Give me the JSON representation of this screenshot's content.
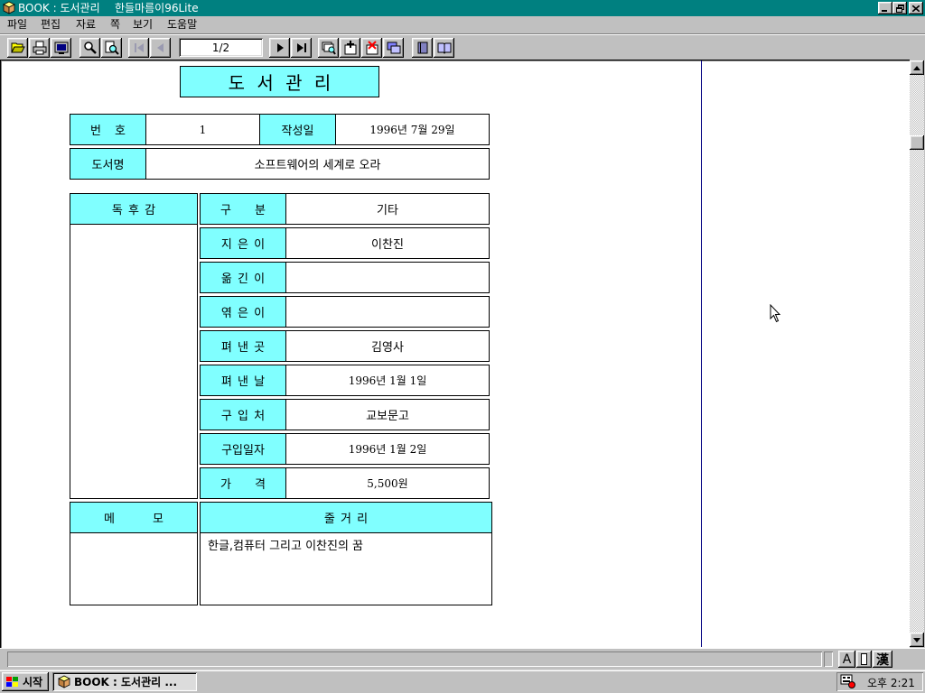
{
  "theme": {
    "titlebar": "#008080",
    "face": "#c0c0c0",
    "label_bg": "#80ffff",
    "page_divider": "#000080"
  },
  "window": {
    "app_name": "BOOK : 도서관리",
    "product_name": "한들마름이96Lite",
    "icon": "app-book-icon"
  },
  "menu": {
    "items": [
      "파일",
      "편집",
      "자료",
      "쪽",
      "보기",
      "도움말"
    ]
  },
  "toolbar": {
    "page_indicator": "1/2",
    "icons": [
      "open-folder-icon",
      "print-icon",
      "screen-view-icon",
      "search-icon",
      "find-next-icon",
      "first-page-icon",
      "prev-page-icon",
      "next-page-icon",
      "last-page-icon",
      "card-search-icon",
      "card-add-icon",
      "card-delete-icon",
      "card-copy-icon",
      "book-closed-icon",
      "book-open-icon"
    ]
  },
  "form": {
    "title": "도 서 관 리",
    "number": {
      "label": "번 호",
      "value": "1"
    },
    "created": {
      "label": "작성일",
      "value": "1996년 7월 29일"
    },
    "book_title": {
      "label": "도서명",
      "value": "소프트웨어의 세계로 오라"
    },
    "review": {
      "label": "독 후 감",
      "value": ""
    },
    "details": [
      {
        "label": "구 분",
        "value": "기타"
      },
      {
        "label": "지 은 이",
        "value": "이찬진"
      },
      {
        "label": "옮 긴 이",
        "value": ""
      },
      {
        "label": "엮 은 이",
        "value": ""
      },
      {
        "label": "펴 낸 곳",
        "value": "김영사"
      },
      {
        "label": "펴 낸 날",
        "value": "1996년 1월 1일"
      },
      {
        "label": "구 입 처",
        "value": "교보문고"
      },
      {
        "label": "구입일자",
        "value": "1996년 1월 2일"
      },
      {
        "label": "가 격",
        "value": "5,500원"
      }
    ],
    "memo": {
      "label": "메 모",
      "value": ""
    },
    "summary": {
      "label": "줄 거 리",
      "value": "한글,컴퓨터 그리고 이찬진의 꿈"
    }
  },
  "statusbar": {
    "input_mode": "A",
    "hanja_mode": "漢"
  },
  "taskbar": {
    "start_label": "시작",
    "task_label": "BOOK : 도서관리 ...",
    "clock": "오후 2:21"
  }
}
